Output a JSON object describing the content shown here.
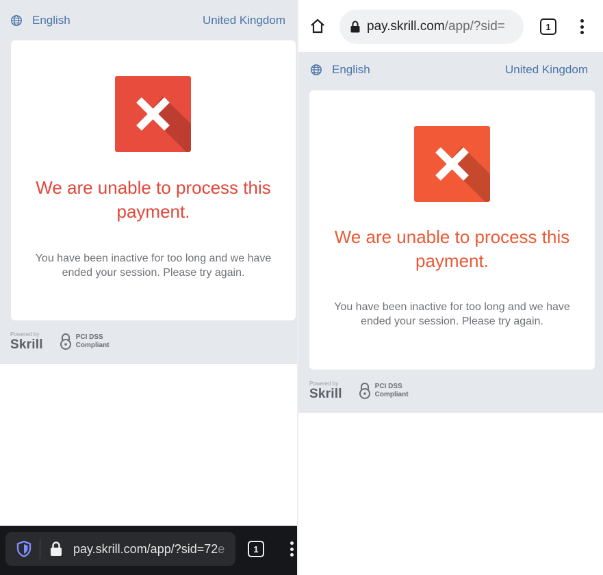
{
  "colors": {
    "link_blue": "#4a73a8",
    "error_left": "#e0483a",
    "error_right": "#ea5a36",
    "x_box_left": "#e74c3c",
    "x_box_right": "#f25a37",
    "page_gray": "#e5e8ec"
  },
  "left": {
    "language": "English",
    "country": "United Kingdom",
    "error_title_line1": "We are unable to process this",
    "error_title_line2": "payment.",
    "error_message_line1": "You have been inactive for too long and we have",
    "error_message_line2": "ended your session. Please try again.",
    "powered_by": "Powered by",
    "brand": "Skrill",
    "pci_line1": "PCI DSS",
    "pci_line2": "Compliant",
    "toolbar": {
      "url_main": "pay.skrill.com/app/?sid=72",
      "url_fade": "e",
      "tab_count": "1",
      "icons": [
        "shield-icon",
        "lock-icon",
        "tab-switcher-icon",
        "overflow-menu-icon"
      ]
    }
  },
  "right": {
    "language": "English",
    "country": "United Kingdom",
    "error_title_line1": "We are unable to process this",
    "error_title_line2": "payment.",
    "error_message_line1": "You have been inactive for too long and we have",
    "error_message_line2": "ended your session. Please try again.",
    "powered_by": "Powered by",
    "brand": "Skrill",
    "pci_line1": "PCI DSS",
    "pci_line2": "Compliant",
    "toolbar": {
      "url_main": "pay.skrill.com",
      "url_fade": "/app/?sid=",
      "tab_count": "1",
      "icons": [
        "home-icon",
        "lock-icon",
        "tab-switcher-icon",
        "overflow-menu-icon"
      ]
    }
  }
}
